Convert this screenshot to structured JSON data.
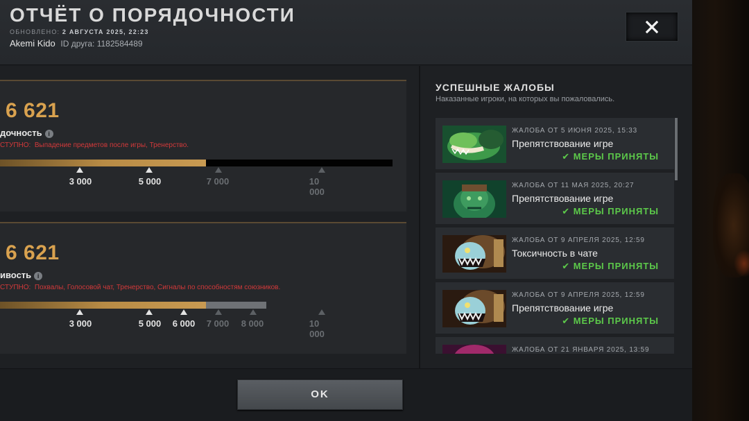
{
  "header": {
    "title": "ОТЧЁТ О ПОРЯДОЧНОСТИ",
    "updated_label": "ОБНОВЛЕНО:",
    "updated_value": "2 АВГУСТА 2025, 22:23",
    "username": "Akemi Kido",
    "friend_id_label": "ID друга:",
    "friend_id": "1182584489",
    "close_icon": "close-icon"
  },
  "cards": [
    {
      "score": "6 621",
      "label": "дочность",
      "unavailable_prefix": "СТУПНО:",
      "unavailable_text": "Выпадение предметов после игры, Тренерство.",
      "progress_value": 6621,
      "ticks": [
        "3 000",
        "5 000",
        "7 000",
        "10",
        "000"
      ]
    },
    {
      "score": "6 621",
      "label": "ивость",
      "unavailable_prefix": "СТУПНО:",
      "unavailable_text": "Похвалы, Голосовой чат, Тренерство, Сигналы по способностям союзников.",
      "progress_value": 6621,
      "ticks": [
        "3 000",
        "5 000",
        "6 000",
        "7 000",
        "8 000",
        "10",
        "000"
      ]
    }
  ],
  "reports_panel": {
    "title": "УСПЕШНЫЕ ЖАЛОБЫ",
    "subtitle": "Наказанные игроки, на которых вы пожаловались.",
    "items": [
      {
        "date": "ЖАЛОБА ОТ 5 ИЮНЯ 2025, 15:33",
        "reason": "Препятствование игре",
        "status": "МЕРЫ ПРИНЯТЫ",
        "hero_icon": "tidehunter-portrait-icon"
      },
      {
        "date": "ЖАЛОБА ОТ 11 МАЯ 2025, 20:27",
        "reason": "Препятствование игре",
        "status": "МЕРЫ ПРИНЯТЫ",
        "hero_icon": "undying-portrait-icon"
      },
      {
        "date": "ЖАЛОБА ОТ 9 АПРЕЛЯ 2025, 12:59",
        "reason": "Токсичность в чате",
        "status": "МЕРЫ ПРИНЯТЫ",
        "hero_icon": "slark-portrait-icon"
      },
      {
        "date": "ЖАЛОБА ОТ 9 АПРЕЛЯ 2025, 12:59",
        "reason": "Препятствование игре",
        "status": "МЕРЫ ПРИНЯТЫ",
        "hero_icon": "slark-portrait-icon"
      },
      {
        "date": "ЖАЛОБА ОТ 21 ЯНВАРЯ 2025, 13:59",
        "reason": "",
        "status": "",
        "hero_icon": "hero-portrait-icon"
      }
    ]
  },
  "footer": {
    "ok_label": "OK"
  },
  "colors": {
    "accent_gold": "#d9a24f",
    "status_green": "#5cc94a",
    "warning_red": "#d2393a"
  }
}
